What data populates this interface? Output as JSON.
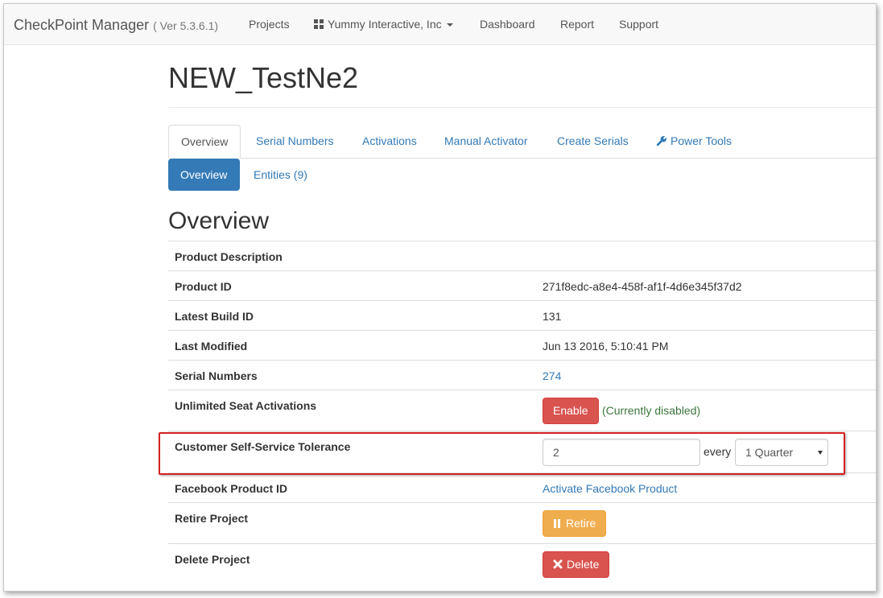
{
  "navbar": {
    "brand": "CheckPoint Manager",
    "version": "( Ver 5.3.6.1)",
    "projects": "Projects",
    "company": "Yummy Interactive, Inc",
    "dashboard": "Dashboard",
    "report": "Report",
    "support": "Support"
  },
  "page": {
    "title": "NEW_TestNe2",
    "section_title": "Overview"
  },
  "tabs": {
    "overview": "Overview",
    "serial_numbers": "Serial Numbers",
    "activations": "Activations",
    "manual_activator": "Manual Activator",
    "create_serials": "Create Serials",
    "power_tools": "Power Tools"
  },
  "subtabs": {
    "overview": "Overview",
    "entities": "Entities (9)"
  },
  "table": {
    "product_description": {
      "label": "Product Description",
      "value": ""
    },
    "product_id": {
      "label": "Product ID",
      "value": "271f8edc-a8e4-458f-af1f-4d6e345f37d2"
    },
    "latest_build_id": {
      "label": "Latest Build ID",
      "value": "131"
    },
    "last_modified": {
      "label": "Last Modified",
      "value": "Jun 13 2016, 5:10:41 PM"
    },
    "serial_numbers": {
      "label": "Serial Numbers",
      "value": "274"
    },
    "unlimited_seat": {
      "label": "Unlimited Seat Activations",
      "button": "Enable",
      "status": "(Currently disabled)"
    },
    "tolerance": {
      "label": "Customer Self-Service Tolerance",
      "input_value": "2",
      "every": "every",
      "period": "1 Quarter"
    },
    "facebook": {
      "label": "Facebook Product ID",
      "link": "Activate Facebook Product"
    },
    "retire": {
      "label": "Retire Project",
      "button": "Retire"
    },
    "delete": {
      "label": "Delete Project",
      "button": "Delete"
    }
  },
  "colors": {
    "link": "#337ab7",
    "danger": "#d9534f",
    "warning": "#f0ad4e",
    "success_text": "#3c763d",
    "highlight": "#d42020"
  }
}
